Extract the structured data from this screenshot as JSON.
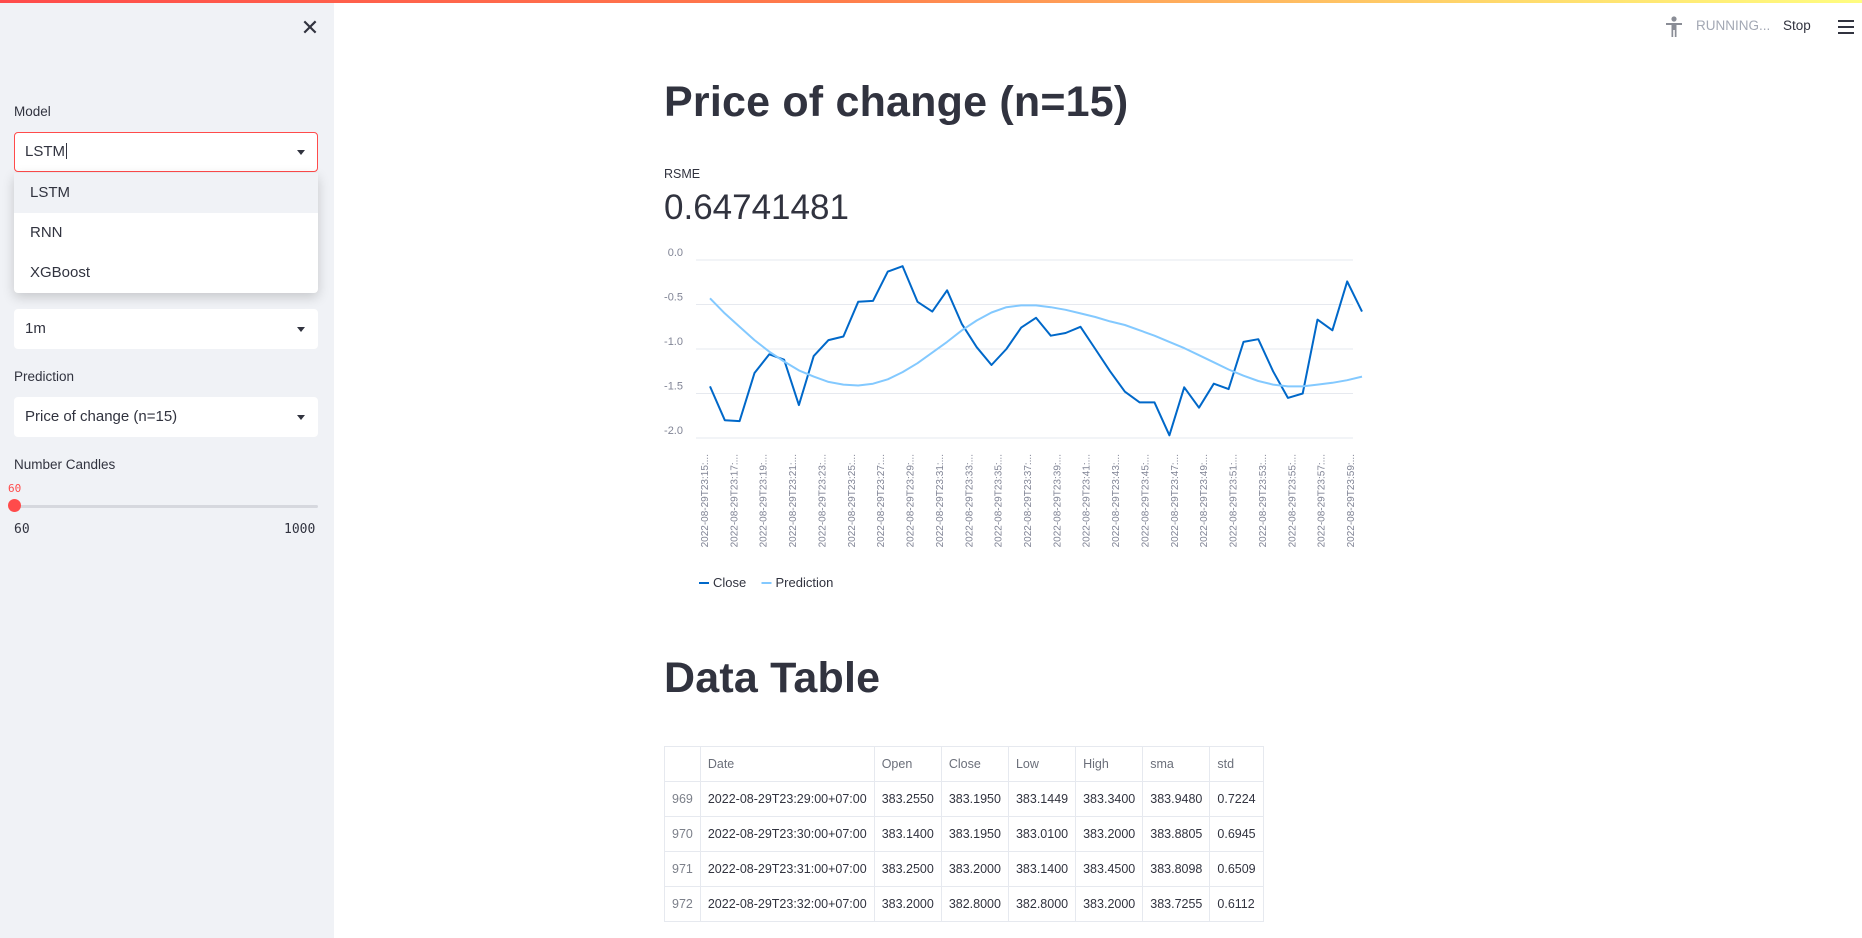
{
  "header": {
    "status": "RUNNING...",
    "stop_label": "Stop",
    "icons": [
      "accessibility-person-icon",
      "hamburger-menu-icon"
    ]
  },
  "sidebar": {
    "close_icon": "✕",
    "model": {
      "label": "Model",
      "value": "LSTM",
      "options": [
        "LSTM",
        "RNN",
        "XGBoost"
      ]
    },
    "time_frame": {
      "value": "1m"
    },
    "prediction": {
      "label": "Prediction",
      "value": "Price of change (n=15)"
    },
    "candles": {
      "label": "Number Candles",
      "value": "60",
      "min": "60",
      "max": "1000",
      "fraction": 0.0
    }
  },
  "main": {
    "title": "Price of change (n=15)",
    "metric_label": "RSME",
    "metric_value": "0.64741481",
    "table_title": "Data Table"
  },
  "chart_data": {
    "type": "line",
    "ylim": [
      -2.0,
      0.0
    ],
    "yticks": [
      "0.0",
      "-0.5",
      "-1.0",
      "-1.5",
      "-2.0"
    ],
    "x_tick_labels": [
      "2022-08-29T23:15:...",
      "2022-08-29T23:17:...",
      "2022-08-29T23:19:...",
      "2022-08-29T23:21:...",
      "2022-08-29T23:23:...",
      "2022-08-29T23:25:...",
      "2022-08-29T23:27:...",
      "2022-08-29T23:29:...",
      "2022-08-29T23:31:...",
      "2022-08-29T23:33:...",
      "2022-08-29T23:35:...",
      "2022-08-29T23:37:...",
      "2022-08-29T23:39:...",
      "2022-08-29T23:41:...",
      "2022-08-29T23:43:...",
      "2022-08-29T23:45:...",
      "2022-08-29T23:47:...",
      "2022-08-29T23:49:...",
      "2022-08-29T23:51:...",
      "2022-08-29T23:53:...",
      "2022-08-29T23:55:...",
      "2022-08-29T23:57:...",
      "2022-08-29T23:59:..."
    ],
    "grid": true,
    "legend": "bottom-left",
    "series": [
      {
        "name": "Close",
        "color": "#0068c9",
        "values": [
          -1.42,
          -1.8,
          -1.81,
          -1.27,
          -1.06,
          -1.12,
          -1.63,
          -1.08,
          -0.9,
          -0.86,
          -0.47,
          -0.46,
          -0.13,
          -0.07,
          -0.47,
          -0.58,
          -0.34,
          -0.72,
          -0.98,
          -1.18,
          -1.0,
          -0.76,
          -0.65,
          -0.85,
          -0.82,
          -0.75,
          -1.0,
          -1.25,
          -1.48,
          -1.6,
          -1.6,
          -1.97,
          -1.43,
          -1.66,
          -1.39,
          -1.45,
          -0.92,
          -0.89,
          -1.25,
          -1.55,
          -1.5,
          -0.67,
          -0.79,
          -0.24,
          -0.58
        ]
      },
      {
        "name": "Prediction",
        "color": "#83c9ff",
        "values": [
          -0.43,
          -0.6,
          -0.75,
          -0.9,
          -1.03,
          -1.14,
          -1.24,
          -1.31,
          -1.37,
          -1.4,
          -1.41,
          -1.39,
          -1.34,
          -1.26,
          -1.16,
          -1.04,
          -0.92,
          -0.79,
          -0.68,
          -0.59,
          -0.53,
          -0.51,
          -0.51,
          -0.53,
          -0.56,
          -0.6,
          -0.64,
          -0.69,
          -0.73,
          -0.79,
          -0.85,
          -0.92,
          -0.99,
          -1.07,
          -1.15,
          -1.23,
          -1.3,
          -1.36,
          -1.4,
          -1.42,
          -1.42,
          -1.4,
          -1.38,
          -1.35,
          -1.31
        ]
      }
    ]
  },
  "table": {
    "columns": [
      "",
      "Date",
      "Open",
      "Close",
      "Low",
      "High",
      "sma",
      "std"
    ],
    "rows": [
      [
        "969",
        "2022-08-29T23:29:00+07:00",
        "383.2550",
        "383.1950",
        "383.1449",
        "383.3400",
        "383.9480",
        "0.7224"
      ],
      [
        "970",
        "2022-08-29T23:30:00+07:00",
        "383.1400",
        "383.1950",
        "383.0100",
        "383.2000",
        "383.8805",
        "0.6945"
      ],
      [
        "971",
        "2022-08-29T23:31:00+07:00",
        "383.2500",
        "383.2000",
        "383.1400",
        "383.4500",
        "383.8098",
        "0.6509"
      ],
      [
        "972",
        "2022-08-29T23:32:00+07:00",
        "383.2000",
        "382.8000",
        "382.8000",
        "383.2000",
        "383.7255",
        "0.6112"
      ]
    ]
  }
}
